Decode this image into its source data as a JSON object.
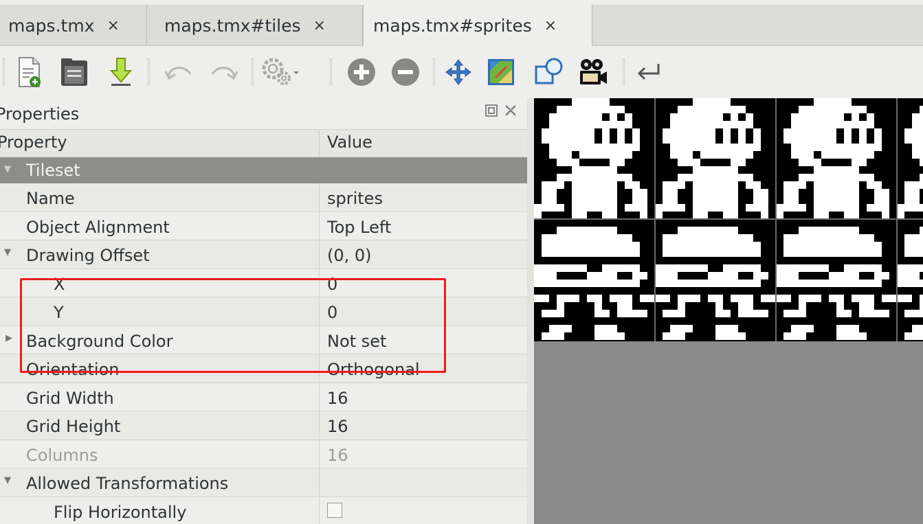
{
  "tabs": [
    {
      "label": "maps.tmx",
      "active": false
    },
    {
      "label": "maps.tmx#tiles",
      "active": false
    },
    {
      "label": "maps.tmx#sprites",
      "active": true
    }
  ],
  "tab_close_glyph": "×",
  "toolbar": {
    "icons": [
      "new-tileset-icon",
      "open-icon",
      "export-icon",
      "undo-icon",
      "redo-icon",
      "settings-icon",
      "add-tile-icon",
      "remove-tile-icon",
      "move-icon",
      "terrain-icon",
      "collision-icon",
      "animation-icon",
      "rotate-icon"
    ]
  },
  "panel": {
    "title": "Properties",
    "columns": {
      "property": "Property",
      "value": "Value"
    }
  },
  "properties": {
    "group_tileset": "Tileset",
    "name": {
      "label": "Name",
      "value": "sprites"
    },
    "object_alignment": {
      "label": "Object Alignment",
      "value": "Top Left"
    },
    "drawing_offset": {
      "label": "Drawing Offset",
      "value": "(0, 0)"
    },
    "x": {
      "label": "X",
      "value": "0"
    },
    "y": {
      "label": "Y",
      "value": "0"
    },
    "background_color": {
      "label": "Background Color",
      "value": "Not set"
    },
    "orientation": {
      "label": "Orientation",
      "value": "Orthogonal"
    },
    "grid_width": {
      "label": "Grid Width",
      "value": "16"
    },
    "grid_height": {
      "label": "Grid Height",
      "value": "16"
    },
    "columns": {
      "label": "Columns",
      "value": "16"
    },
    "allowed_transformations": {
      "label": "Allowed Transformations"
    },
    "flip_horizontally": {
      "label": "Flip Horizontally",
      "checked": false
    }
  },
  "colors": {
    "highlight": "#ee1c1c",
    "group_row": "#8d8d8b",
    "tile_bg": "#000000",
    "view_bg": "#8a8a8a"
  }
}
